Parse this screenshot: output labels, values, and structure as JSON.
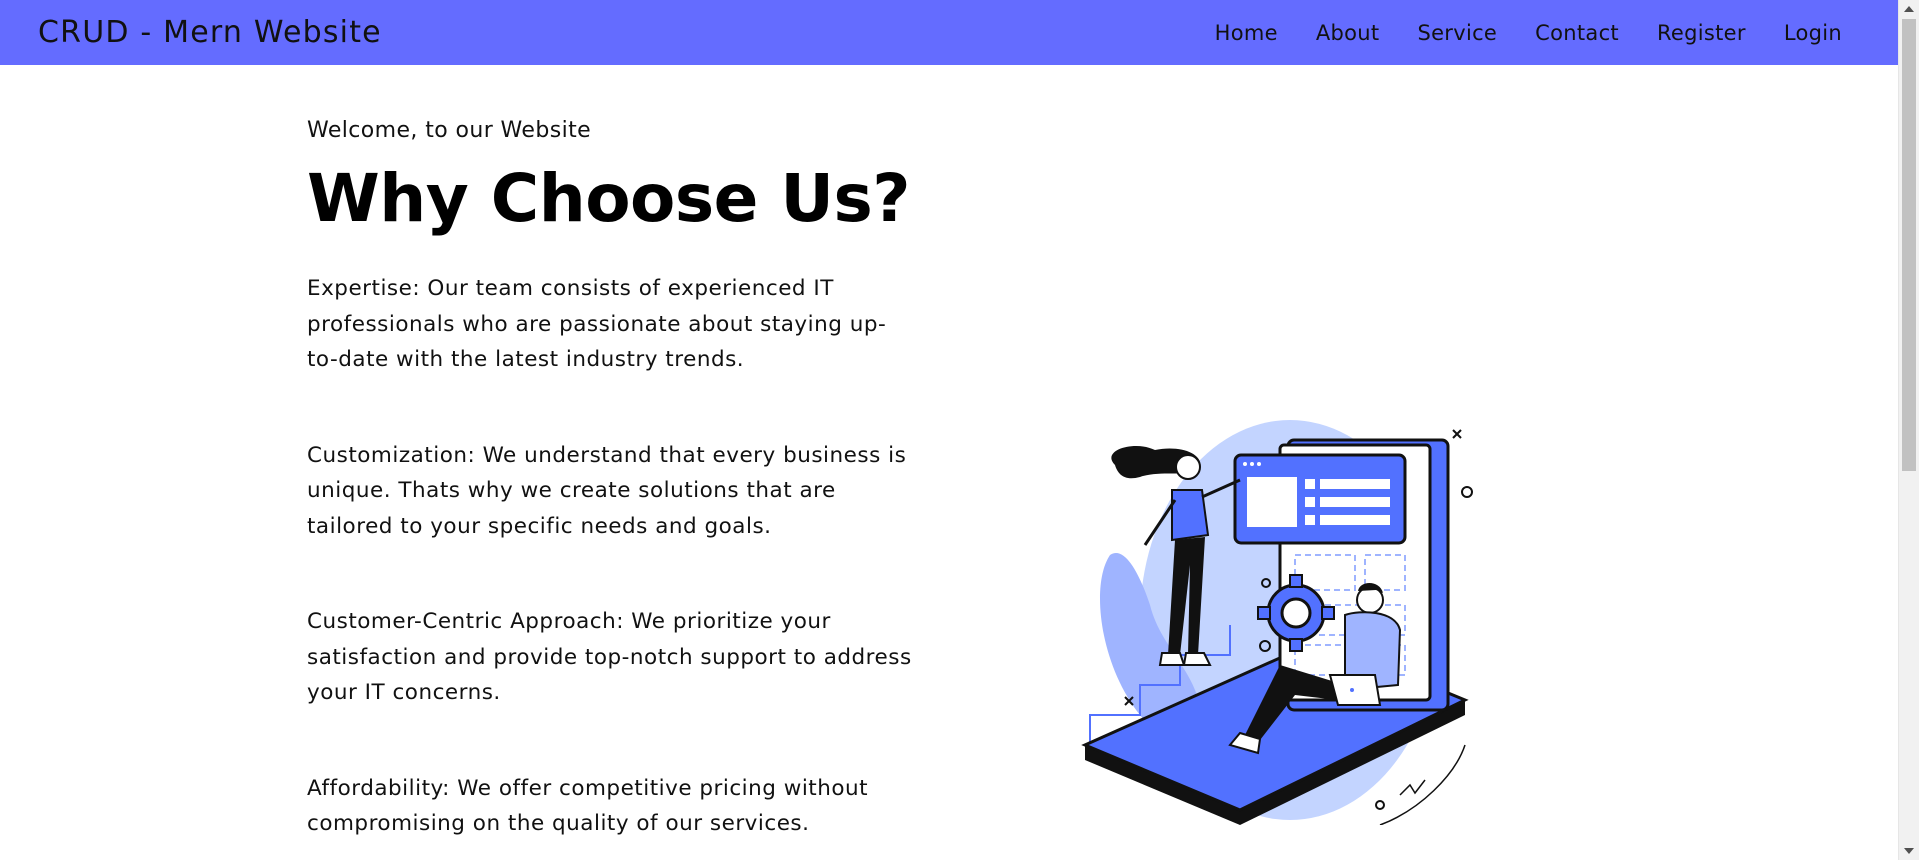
{
  "navbar": {
    "brand": "CRUD - Mern Website",
    "links": [
      "Home",
      "About",
      "Service",
      "Contact",
      "Register",
      "Login"
    ],
    "background": "#646cff"
  },
  "main": {
    "welcome": "Welcome, to our Website",
    "heading": "Why Choose Us?",
    "paragraphs": [
      "Expertise: Our team consists of experienced IT professionals who are passionate about staying up-to-date with the latest industry trends.",
      "Customization: We understand that every business is unique. Thats why we create solutions that are tailored to your specific needs and goals.",
      "Customer-Centric Approach: We prioritize your satisfaction and provide top-notch support to address your IT concerns.",
      "Affordability: We offer competitive pricing without compromising on the quality of our services."
    ]
  },
  "illustration": {
    "icon": "team-collaboration-illustration",
    "colors": {
      "primary": "#5271ff",
      "light": "#c3d4ff",
      "outline": "#111111"
    }
  }
}
